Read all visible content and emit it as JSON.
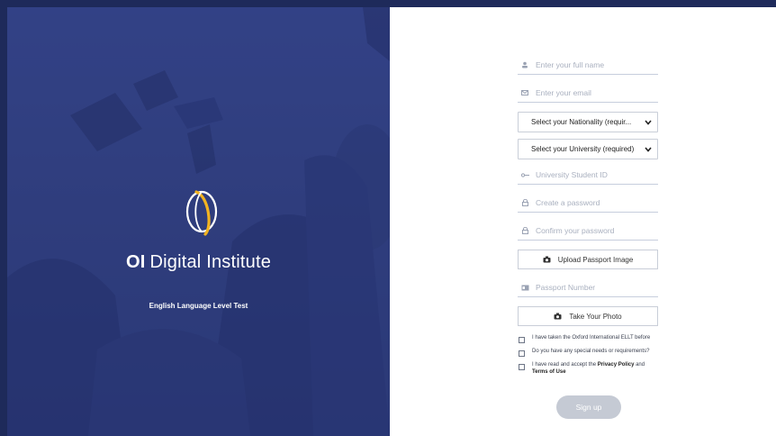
{
  "hero": {
    "brand_prefix": "OI",
    "brand_name": "Digital Institute",
    "tagline": "English Language Level Test"
  },
  "form": {
    "full_name": {
      "placeholder": "Enter your full name",
      "icon": "person-icon"
    },
    "email": {
      "placeholder": "Enter your email",
      "icon": "envelope-icon"
    },
    "nationality": {
      "selected": "Select your Nationality (requir..."
    },
    "university": {
      "selected": "Select your University (required)"
    },
    "student_id": {
      "placeholder": "University Student ID",
      "icon": "key-icon"
    },
    "password": {
      "placeholder": "Create a password",
      "icon": "lock-icon"
    },
    "confirm_password": {
      "placeholder": "Confirm your password",
      "icon": "lock-icon"
    },
    "upload_passport_label": "Upload Passport Image",
    "passport_number": {
      "placeholder": "Passport Number",
      "icon": "id-card-icon"
    },
    "take_photo_label": "Take Your Photo",
    "checks": {
      "ellt": "I have taken the Oxford International ELLT before",
      "special_needs": "Do you have any special needs or requirements?",
      "privacy_pre": "I have read and accept the ",
      "privacy_link": "Privacy Policy",
      "privacy_mid": " and ",
      "terms_link": "Terms of Use"
    },
    "signup_label": "Sign up"
  },
  "colors": {
    "frame": "#1e2a5a",
    "hero": "#34437f",
    "accent_gold": "#f2b321",
    "button_disabled": "#c5cad4"
  }
}
